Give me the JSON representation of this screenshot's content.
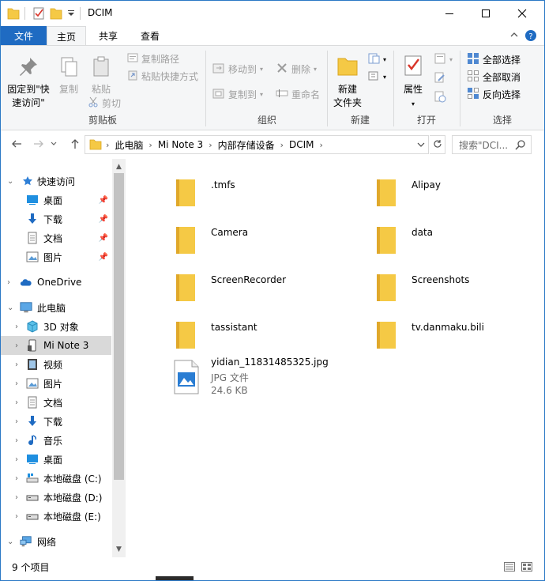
{
  "window": {
    "title": "DCIM",
    "icons": [
      "folder-icon",
      "properties-icon",
      "new-folder-icon",
      "dropdown-icon"
    ],
    "controls": [
      "minimize-icon",
      "maximize-icon",
      "close-icon"
    ]
  },
  "ribbon_tabs": {
    "file": "文件",
    "home": "主页",
    "share": "共享",
    "view": "查看",
    "active": "主页"
  },
  "ribbon": {
    "clipboard": {
      "label": "剪贴板",
      "pin_line1": "固定到\"快",
      "pin_line2": "速访问\"",
      "copy": "复制",
      "paste": "粘贴",
      "copy_path": "复制路径",
      "paste_shortcut": "粘贴快捷方式",
      "cut": "剪切"
    },
    "organize": {
      "label": "组织",
      "move_to": "移动到",
      "copy_to": "复制到",
      "delete": "删除",
      "rename": "重命名"
    },
    "new": {
      "label": "新建",
      "new_folder_line1": "新建",
      "new_folder_line2": "文件夹"
    },
    "open": {
      "label": "打开",
      "properties": "属性"
    },
    "select": {
      "label": "选择",
      "select_all": "全部选择",
      "select_none": "全部取消",
      "invert": "反向选择"
    }
  },
  "address": {
    "crumbs": [
      "此电脑",
      "Mi Note 3",
      "内部存储设备",
      "DCIM"
    ],
    "search_placeholder": "搜索\"DCI..."
  },
  "nav": {
    "quick_access": "快速访问",
    "desktop": "桌面",
    "downloads": "下载",
    "documents": "文档",
    "pictures": "图片",
    "onedrive": "OneDrive",
    "this_pc": "此电脑",
    "objects3d": "3D 对象",
    "mi_note": "Mi Note 3",
    "videos": "视频",
    "pictures2": "图片",
    "documents2": "文档",
    "downloads2": "下载",
    "music": "音乐",
    "desktop2": "桌面",
    "disk_c": "本地磁盘 (C:)",
    "disk_d": "本地磁盘 (D:)",
    "disk_e": "本地磁盘 (E:)",
    "network": "网络"
  },
  "files": [
    {
      "name": ".tmfs",
      "type": "folder"
    },
    {
      "name": "Alipay",
      "type": "folder"
    },
    {
      "name": "Camera",
      "type": "folder"
    },
    {
      "name": "data",
      "type": "folder"
    },
    {
      "name": "ScreenRecorder",
      "type": "folder"
    },
    {
      "name": "Screenshots",
      "type": "folder"
    },
    {
      "name": "tassistant",
      "type": "folder"
    },
    {
      "name": "tv.danmaku.bili",
      "type": "folder"
    },
    {
      "name": "yidian_11831485325.jpg",
      "type": "image",
      "kind": "JPG 文件",
      "size": "24.6 KB"
    }
  ],
  "status": {
    "count": "9 个项目"
  },
  "colors": {
    "accent": "#1f6bc2",
    "folder": "#f5c945",
    "selected": "#d9d9d9"
  }
}
